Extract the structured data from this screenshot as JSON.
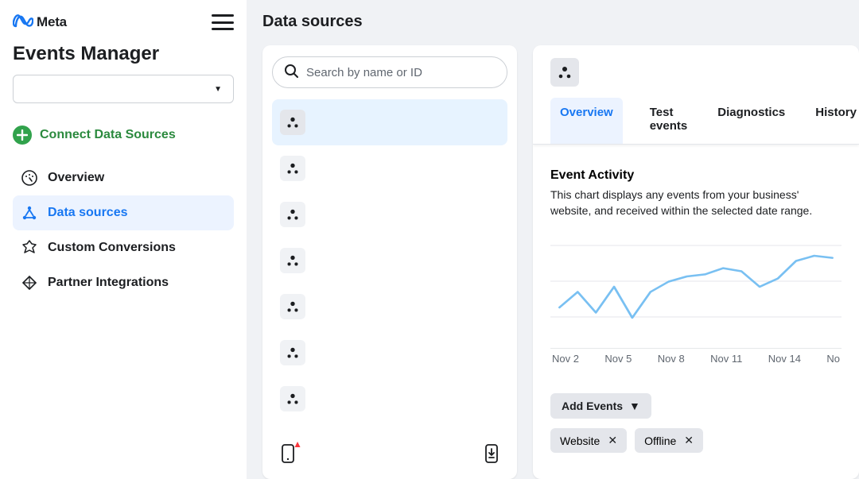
{
  "brand": {
    "name": "Meta"
  },
  "sidebar": {
    "title": "Events Manager",
    "connect_label": "Connect Data Sources",
    "items": [
      {
        "label": "Overview"
      },
      {
        "label": "Data sources"
      },
      {
        "label": "Custom Conversions"
      },
      {
        "label": "Partner Integrations"
      }
    ]
  },
  "page": {
    "title": "Data sources"
  },
  "search": {
    "placeholder": "Search by name or ID"
  },
  "data_sources": {
    "items": [
      {
        "selected": true
      },
      {
        "selected": false
      },
      {
        "selected": false
      },
      {
        "selected": false
      },
      {
        "selected": false
      },
      {
        "selected": false
      },
      {
        "selected": false
      }
    ]
  },
  "tabs": [
    {
      "label": "Overview",
      "active": true
    },
    {
      "label": "Test events",
      "active": false
    },
    {
      "label": "Diagnostics",
      "active": false
    },
    {
      "label": "History",
      "active": false
    }
  ],
  "event_activity": {
    "title": "Event Activity",
    "description": "This chart displays any events from your business' website, and received within the selected date range.",
    "add_events_label": "Add Events",
    "filter_tags": [
      {
        "label": "Website"
      },
      {
        "label": "Offline"
      }
    ]
  },
  "chart_data": {
    "type": "line",
    "title": "Event Activity",
    "xlabel": "",
    "ylabel": "",
    "x_ticks": [
      "Nov 2",
      "Nov 5",
      "Nov 8",
      "Nov 11",
      "Nov 14",
      "No"
    ],
    "categories": [
      "Nov 1",
      "Nov 2",
      "Nov 3",
      "Nov 4",
      "Nov 5",
      "Nov 6",
      "Nov 7",
      "Nov 8",
      "Nov 9",
      "Nov 10",
      "Nov 11",
      "Nov 12",
      "Nov 13",
      "Nov 14",
      "Nov 15",
      "Nov 16"
    ],
    "series": [
      {
        "name": "Events",
        "values": [
          40,
          55,
          35,
          60,
          30,
          55,
          65,
          70,
          72,
          78,
          75,
          60,
          68,
          85,
          90,
          88
        ]
      }
    ],
    "ylim": [
      0,
      100
    ],
    "color": "#79c0f2"
  }
}
